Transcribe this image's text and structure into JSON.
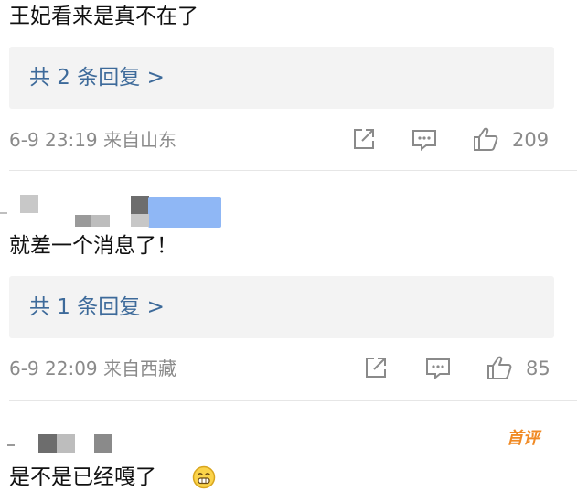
{
  "comments": [
    {
      "text": "王妃看来是真不在了",
      "reply_label": "共 2 条回复 >",
      "date": "6-9 23:19",
      "location": "来自山东",
      "likes": "209"
    },
    {
      "text": "就差一个消息了！",
      "reply_label": "共 1 条回复 >",
      "date": "6-9 22:09",
      "location": "来自西藏",
      "likes": "85"
    },
    {
      "text": "是不是已经嘎了",
      "badge": "首评",
      "emoji": "grinning-face-emoji"
    }
  ],
  "icons": {
    "share": "share-icon",
    "comment": "comment-icon",
    "like": "thumbs-up-icon"
  },
  "colors": {
    "reply_link": "#3d6a9a",
    "meta_gray": "#8a8a8a",
    "reply_bg": "#f3f3f3",
    "badge_orange": "#f08a24",
    "avatar_blur_blue": "#8fb7f5"
  }
}
